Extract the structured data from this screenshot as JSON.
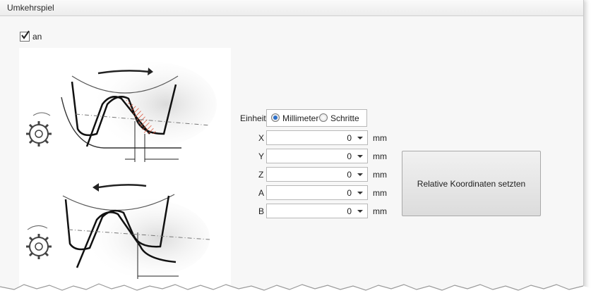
{
  "window": {
    "title": "Umkehrspiel"
  },
  "enable_checkbox": {
    "label": "an",
    "checked": true
  },
  "unit": {
    "label": "Einheit",
    "options": [
      {
        "label": "Millimeter",
        "selected": true
      },
      {
        "label": "Schritte",
        "selected": false
      }
    ]
  },
  "axes": [
    {
      "label": "X",
      "value": "0",
      "unit": "mm"
    },
    {
      "label": "Y",
      "value": "0",
      "unit": "mm"
    },
    {
      "label": "Z",
      "value": "0",
      "unit": "mm"
    },
    {
      "label": "A",
      "value": "0",
      "unit": "mm"
    },
    {
      "label": "B",
      "value": "0",
      "unit": "mm"
    }
  ],
  "action_button": {
    "label": "Relative Koordinaten setzten"
  },
  "colors": {
    "accent": "#2b6fc9",
    "hatch": "#d9472b"
  },
  "icons": [
    "checkmark-icon",
    "gear-icon",
    "rotation-arrow-icon",
    "chevron-down-icon"
  ]
}
